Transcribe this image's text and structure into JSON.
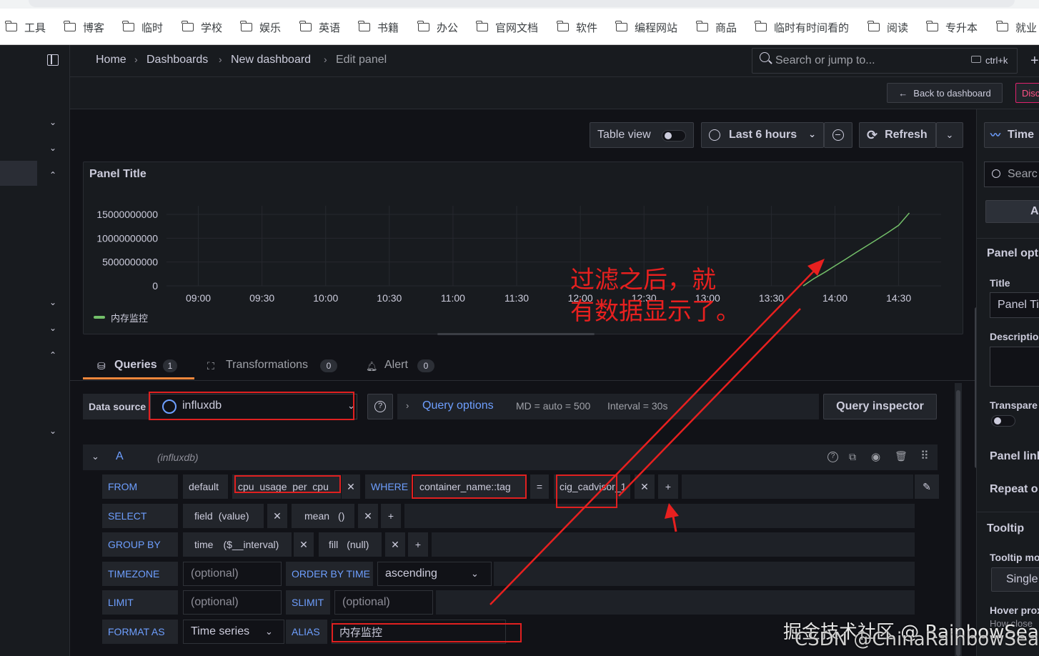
{
  "bookmarks": [
    "工具",
    "博客",
    "临时",
    "学校",
    "娱乐",
    "英语",
    "书籍",
    "办公",
    "官网文档",
    "软件",
    "编程网站",
    "商品",
    "临时有时间看的",
    "阅读",
    "专升本",
    "就业"
  ],
  "breadcrumb": {
    "home": "Home",
    "dashboards": "Dashboards",
    "dashboard": "New dashboard",
    "current": "Edit panel",
    "sep": "›"
  },
  "search": {
    "placeholder": "Search or jump to...",
    "shortcut": "ctrl+k"
  },
  "actions": {
    "back": "Back to dashboard",
    "discard": "Disc"
  },
  "toolbar": {
    "table_view": "Table view",
    "time_range": "Last 6 hours",
    "refresh": "Refresh"
  },
  "panel": {
    "title": "Panel Title"
  },
  "chart_data": {
    "type": "line",
    "title": "Panel Title",
    "y_ticks": [
      "15000000000",
      "10000000000",
      "5000000000",
      "0"
    ],
    "x_ticks": [
      "09:00",
      "09:30",
      "10:00",
      "10:30",
      "11:00",
      "11:30",
      "12:00",
      "12:30",
      "13:00",
      "13:30",
      "14:00",
      "14:30"
    ],
    "ylim": [
      0,
      15000000000
    ],
    "series": [
      {
        "name": "内存监控",
        "color": "#73bf69",
        "x": [
          "13:45",
          "13:50",
          "13:55",
          "14:00",
          "14:05",
          "14:10",
          "14:15",
          "14:20",
          "14:25",
          "14:30",
          "14:35"
        ],
        "values": [
          0,
          1500000000,
          2800000000,
          4200000000,
          5600000000,
          7000000000,
          8400000000,
          9800000000,
          11200000000,
          12700000000,
          15300000000
        ]
      }
    ]
  },
  "tabs": {
    "queries": "Queries",
    "queries_count": "1",
    "transformations": "Transformations",
    "transformations_count": "0",
    "alert": "Alert",
    "alert_count": "0"
  },
  "datasource": {
    "label": "Data source",
    "value": "influxdb"
  },
  "query_options": {
    "label": "Query options",
    "md": "MD = auto = 500",
    "interval": "Interval = 30s",
    "inspector": "Query inspector"
  },
  "query": {
    "ref": "A",
    "source": "(influxdb)",
    "from_label": "FROM",
    "from_db": "default",
    "measurement": "cpu_usage_per_cpu",
    "where_label": "WHERE",
    "where_key": "container_name::tag",
    "where_op": "=",
    "where_value": "cig_cadvisor_1",
    "select_label": "SELECT",
    "select_field": "field",
    "select_field_arg": "(value)",
    "select_fn": "mean",
    "select_fn_arg": "()",
    "group_label": "GROUP BY",
    "group_time": "time",
    "group_time_arg": "($__interval)",
    "group_fill": "fill",
    "group_fill_arg": "(null)",
    "timezone_label": "TIMEZONE",
    "timezone_placeholder": "(optional)",
    "order_label": "ORDER BY TIME",
    "order_value": "ascending",
    "limit_label": "LIMIT",
    "limit_placeholder": "(optional)",
    "slimit_label": "SLIMIT",
    "slimit_placeholder": "(optional)",
    "format_label": "FORMAT AS",
    "format_value": "Time series",
    "alias_label": "ALIAS",
    "alias_value": "内存监控"
  },
  "right_pane": {
    "time": "Time",
    "search": "Searc",
    "all": "A",
    "panel_options": "Panel opti",
    "title_label": "Title",
    "title_value": "Panel Ti",
    "description_label": "Descriptio",
    "transparent_label": "Transpare",
    "panel_links": "Panel link",
    "repeat_options": "Repeat o",
    "tooltip": "Tooltip",
    "tooltip_mode": "Tooltip mo",
    "tooltip_single": "Single",
    "hover_proximity": "Hover prox",
    "hover_note": "How close"
  },
  "annotation": {
    "line1": "过滤之后，就",
    "line2": "有数据显示了。"
  },
  "watermarks": {
    "juejin": "掘金技术社区 @ RainbowSea",
    "csdn": "CSDN @ChinaRainbowSea"
  },
  "colors": {
    "accent": "#6e9fff",
    "series": "#73bf69",
    "annotation": "#e8201f",
    "tab_underline": "#f5873c"
  }
}
